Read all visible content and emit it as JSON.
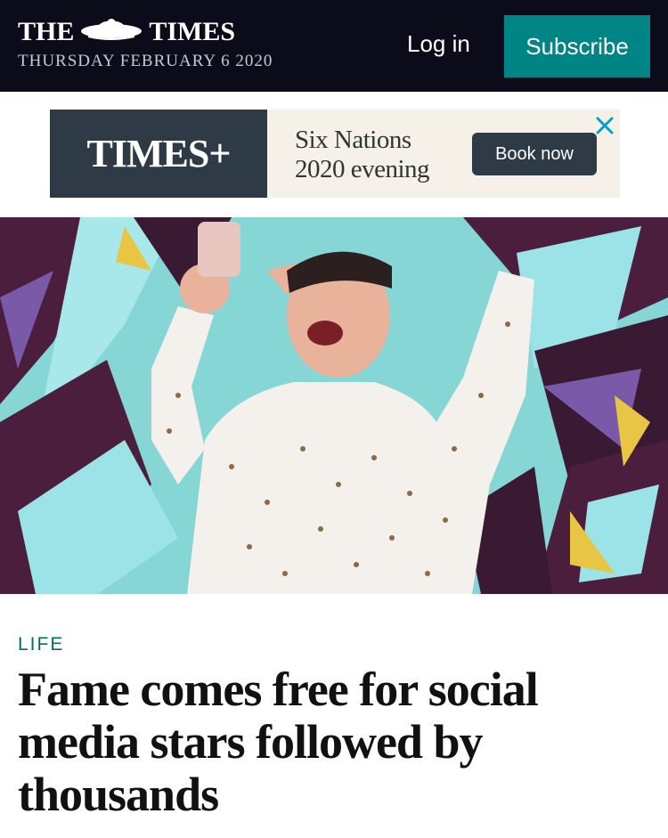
{
  "header": {
    "brand_left": "THE",
    "brand_right": "TIMES",
    "crest_icon": "royal-crest-icon",
    "date": "THURSDAY FEBRUARY 6 2020",
    "login_label": "Log in",
    "subscribe_label": "Subscribe",
    "colors": {
      "background": "#0b0b1a",
      "subscribe": "#008587"
    }
  },
  "ad": {
    "logo": "TIMES+",
    "text_line1": "Six Nations",
    "text_line2": "2020 evening",
    "button_label": "Book now",
    "close_icon": "close-icon",
    "colors": {
      "panel": "#2e3a45",
      "background": "#f5f0e8",
      "close": "#00a3c4"
    }
  },
  "hero": {
    "image": "man-taking-selfie-graffiti-photo"
  },
  "article": {
    "section": "LIFE",
    "headline": "Fame comes free for social media stars followed by thousands",
    "colors": {
      "section": "#0a6a66"
    }
  }
}
